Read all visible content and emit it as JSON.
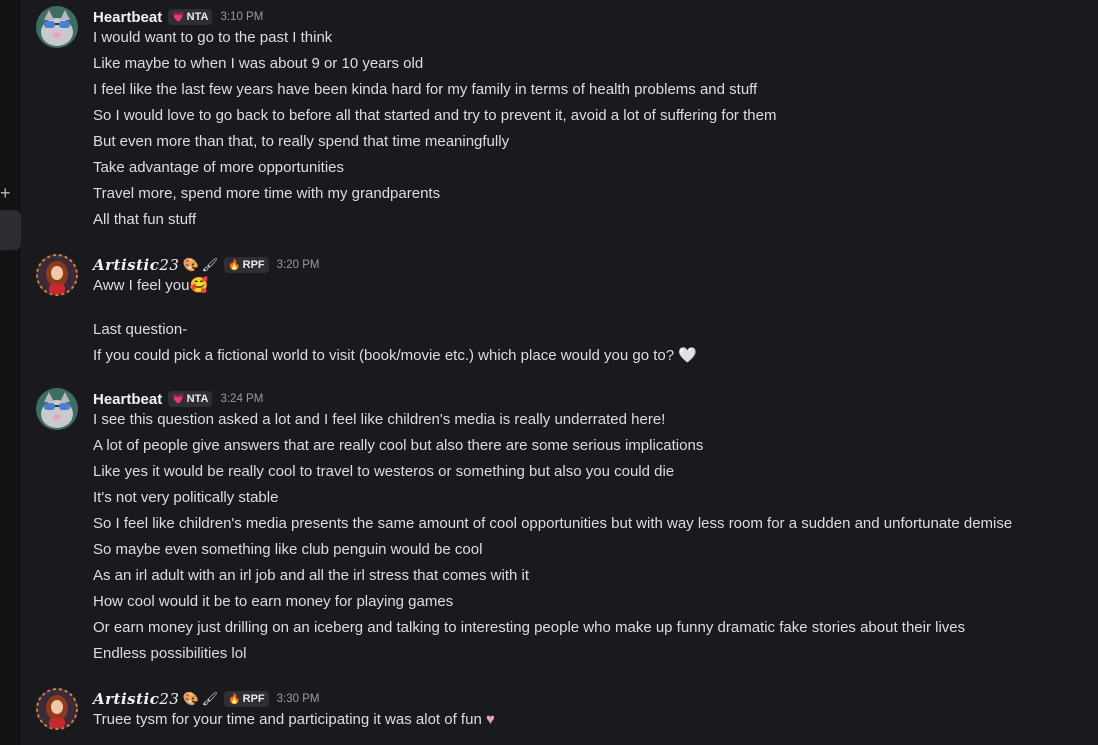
{
  "messages": [
    {
      "author": "Heartbeat",
      "tag": "NTA",
      "tag_icon": "pink-heart-badge-icon",
      "time": "3:10 PM",
      "lines": [
        "I would want to go to the past I think",
        "Like maybe to when I was about 9 or 10 years old",
        "I feel like the last few years have been kinda hard for my family in terms of health problems and stuff",
        "So I would love to go back to before all that started and try to prevent it, avoid a lot of suffering for them",
        "But even more than that, to really spend that time meaningfully",
        "Take advantage of more opportunities",
        "Travel more, spend more time with my grandparents",
        "All that fun stuff"
      ]
    },
    {
      "author_name": "Artistic",
      "author_num": "23",
      "tag": "RPF",
      "tag_icon": "fire-badge-icon",
      "time": "3:20 PM",
      "line1": "Aww I feel you",
      "line2": "Last question-",
      "line3": "If you could pick a fictional world to visit (book/movie etc.) which place would you go to?"
    },
    {
      "author": "Heartbeat",
      "tag": "NTA",
      "tag_icon": "pink-heart-badge-icon",
      "time": "3:24 PM",
      "lines": [
        "I see this question asked a lot and I feel like children's media is really underrated here!",
        "A lot of people give answers that are really cool but also there are some serious implications",
        "Like yes it would be really cool to travel to westeros or something but also you could die",
        "It's not very politically stable",
        "So I feel like children's media presents the same amount of cool opportunities but with way less room for a sudden and unfortunate demise",
        "So maybe even something like club penguin would be cool",
        "As an irl adult with an irl job and all the irl stress that comes with it",
        "How cool would it be to earn money for playing games",
        "Or earn money just drilling on an iceberg and talking to interesting people who make up funny dramatic fake stories about their lives",
        "Endless possibilities lol"
      ]
    },
    {
      "author_name": "Artistic",
      "author_num": "23",
      "tag": "RPF",
      "tag_icon": "fire-badge-icon",
      "time": "3:30 PM",
      "line1": "Truee tysm for your time and participating it was alot of fun"
    }
  ],
  "colors": {
    "background": "#1a1a1e",
    "text": "#dbdee1",
    "username": "#f2f3f5",
    "timestamp": "#949ba4",
    "tag_bg": "#2e2f34"
  }
}
